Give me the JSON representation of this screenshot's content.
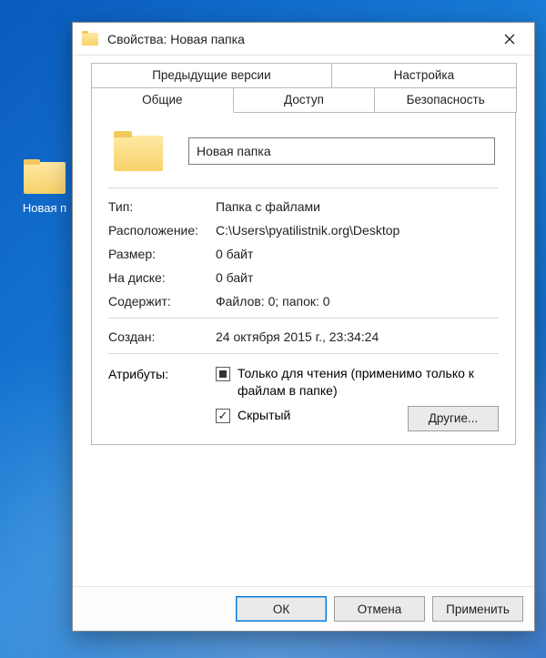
{
  "desktop": {
    "icon_label": "Новая п"
  },
  "dialog": {
    "title": "Свойства: Новая папка",
    "tabs": {
      "prev_versions": "Предыдущие версии",
      "settings": "Настройка",
      "general": "Общие",
      "sharing": "Доступ",
      "security": "Безопасность"
    },
    "general": {
      "name_value": "Новая папка",
      "type": {
        "label": "Тип:",
        "value": "Папка с файлами"
      },
      "location": {
        "label": "Расположение:",
        "value": "C:\\Users\\pyatilistnik.org\\Desktop"
      },
      "size": {
        "label": "Размер:",
        "value": "0 байт"
      },
      "size_on_disk": {
        "label": "На диске:",
        "value": "0 байт"
      },
      "contains": {
        "label": "Содержит:",
        "value": "Файлов: 0; папок: 0"
      },
      "created": {
        "label": "Создан:",
        "value": "24 октября 2015 г., 23:34:24"
      },
      "attributes": {
        "label": "Атрибуты:",
        "readonly": "Только для чтения (применимо только к файлам в папке)",
        "hidden": "Скрытый",
        "other_button": "Другие..."
      }
    },
    "buttons": {
      "ok": "ОК",
      "cancel": "Отмена",
      "apply": "Применить"
    }
  }
}
